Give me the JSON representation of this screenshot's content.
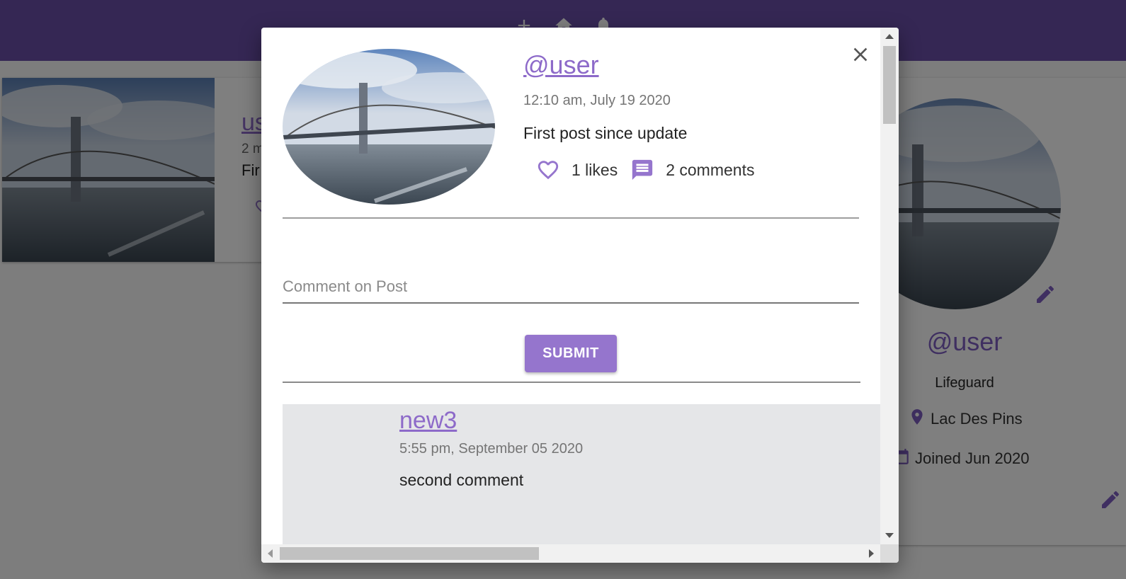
{
  "colors": {
    "appbar": "#6a4ea8",
    "accent": "#9575cd",
    "link": "#8d6ac9",
    "comment_bg": "#e5e6e8"
  },
  "background_feed": {
    "post_user_partial": "us",
    "post_time_partial": "2 m",
    "post_body_partial": "Fir"
  },
  "profile": {
    "name": "@user",
    "occupation": "Lifeguard",
    "location": "Lac Des Pins",
    "joined": "Joined Jun 2020",
    "icons": [
      "location-pin-icon",
      "calendar-icon",
      "edit-pencil-icon"
    ]
  },
  "modal": {
    "post": {
      "user": "@user",
      "time": "12:10 am, July 19 2020",
      "body": "First post since update",
      "likes": "1 likes",
      "comments": "2 comments"
    },
    "comment_placeholder": "Comment on Post",
    "submit_label": "SUBMIT",
    "comments": [
      {
        "user": "new3",
        "time": "5:55 pm, September 05 2020",
        "body": "second comment"
      }
    ]
  }
}
